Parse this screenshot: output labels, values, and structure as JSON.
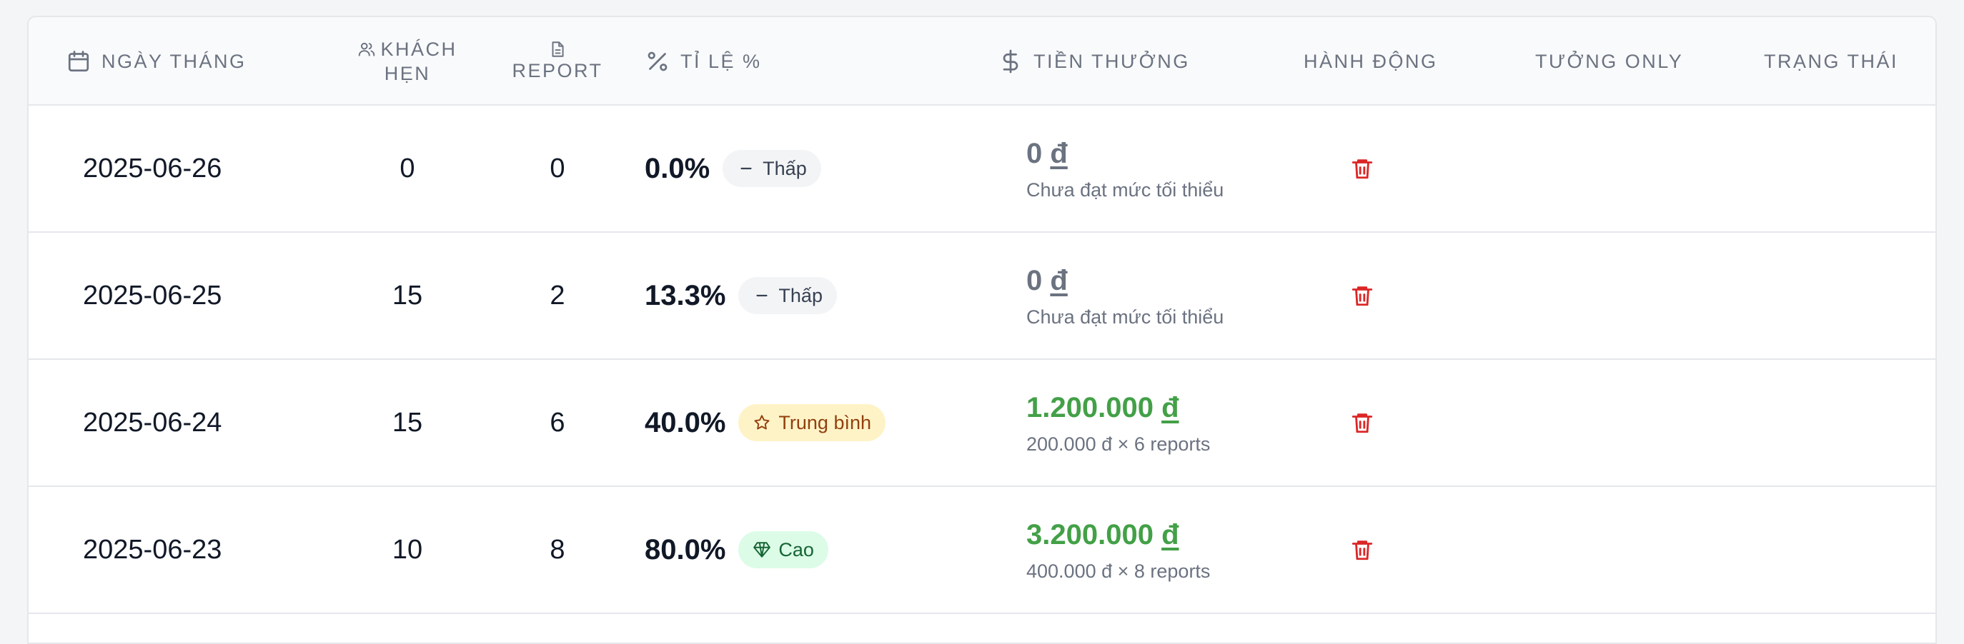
{
  "colors": {
    "header_bg": "#f9fafb",
    "low_badge_bg": "#f3f4f6",
    "mid_badge_bg": "#fef3c7",
    "mid_badge_text": "#92400e",
    "high_badge_bg": "#dcfce7",
    "high_badge_text": "#166534",
    "amount_zero": "#6b7280",
    "amount_positive": "#43a047",
    "delete_red": "#dc2626"
  },
  "headers": {
    "date": "NGÀY THÁNG",
    "customers_line1": "KHÁCH",
    "customers_line2": "HẸN",
    "report": "REPORT",
    "rate": "TỈ LỆ %",
    "bonus": "TIỀN THƯỞNG",
    "action": "HÀNH ĐỘNG",
    "tuong_only": "TƯỞNG ONLY",
    "status": "TRẠNG THÁI"
  },
  "header_icons": {
    "date": "calendar-icon",
    "customers": "users-icon",
    "report": "document-icon",
    "rate": "percent-icon",
    "bonus": "dollar-icon"
  },
  "rows": [
    {
      "date": "2025-06-26",
      "customers": "0",
      "reports": "0",
      "rate": "0.0%",
      "level": "Thấp",
      "level_icon": "minus-icon",
      "amount": "0",
      "currency": "đ",
      "note": "Chưa đạt mức tối thiểu",
      "action_icon": "trash-icon"
    },
    {
      "date": "2025-06-25",
      "customers": "15",
      "reports": "2",
      "rate": "13.3%",
      "level": "Thấp",
      "level_icon": "minus-icon",
      "amount": "0",
      "currency": "đ",
      "note": "Chưa đạt mức tối thiểu",
      "action_icon": "trash-icon"
    },
    {
      "date": "2025-06-24",
      "customers": "15",
      "reports": "6",
      "rate": "40.0%",
      "level": "Trung bình",
      "level_icon": "star-icon",
      "amount": "1.200.000",
      "currency": "đ",
      "note": "200.000 đ × 6 reports",
      "action_icon": "trash-icon"
    },
    {
      "date": "2025-06-23",
      "customers": "10",
      "reports": "8",
      "rate": "80.0%",
      "level": "Cao",
      "level_icon": "gem-icon",
      "amount": "3.200.000",
      "currency": "đ",
      "note": "400.000 đ × 8 reports",
      "action_icon": "trash-icon"
    }
  ]
}
